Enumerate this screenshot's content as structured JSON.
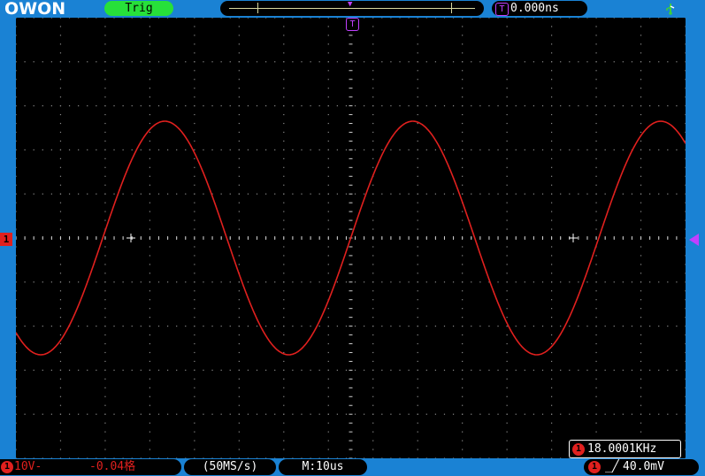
{
  "brand": {
    "logo_text": "OWON"
  },
  "top": {
    "trigger_state": "Trig",
    "trigger_position_badge": "T",
    "trigger_delay": "0.000ns"
  },
  "channel1": {
    "badge": "1",
    "volts_per_div": "10V-",
    "offset": "-0.04格",
    "color": "#e0201e"
  },
  "acquisition": {
    "sample_rate": "(50MS/s)",
    "timebase": "M:10us"
  },
  "trigger": {
    "source_badge": "1",
    "edge_symbol": "_╱",
    "level": "40.0mV"
  },
  "measurement": {
    "badge": "1",
    "frequency": "18.0001KHz"
  },
  "icons": {
    "usb": "usb-icon",
    "trigger_level": "triangle-left-marker",
    "channel_ground": "channel-1-ground-marker"
  },
  "colors": {
    "frame": "#1a82d4",
    "screen": "#000000",
    "trace": "#e0201e",
    "trigger": "#c040ff",
    "trig_status": "#27e03a"
  },
  "waveform": {
    "type": "sine",
    "frequency_khz": 18.0001,
    "amplitude_div": 2.65,
    "phase_at_center": "rising-zero-crossing"
  }
}
